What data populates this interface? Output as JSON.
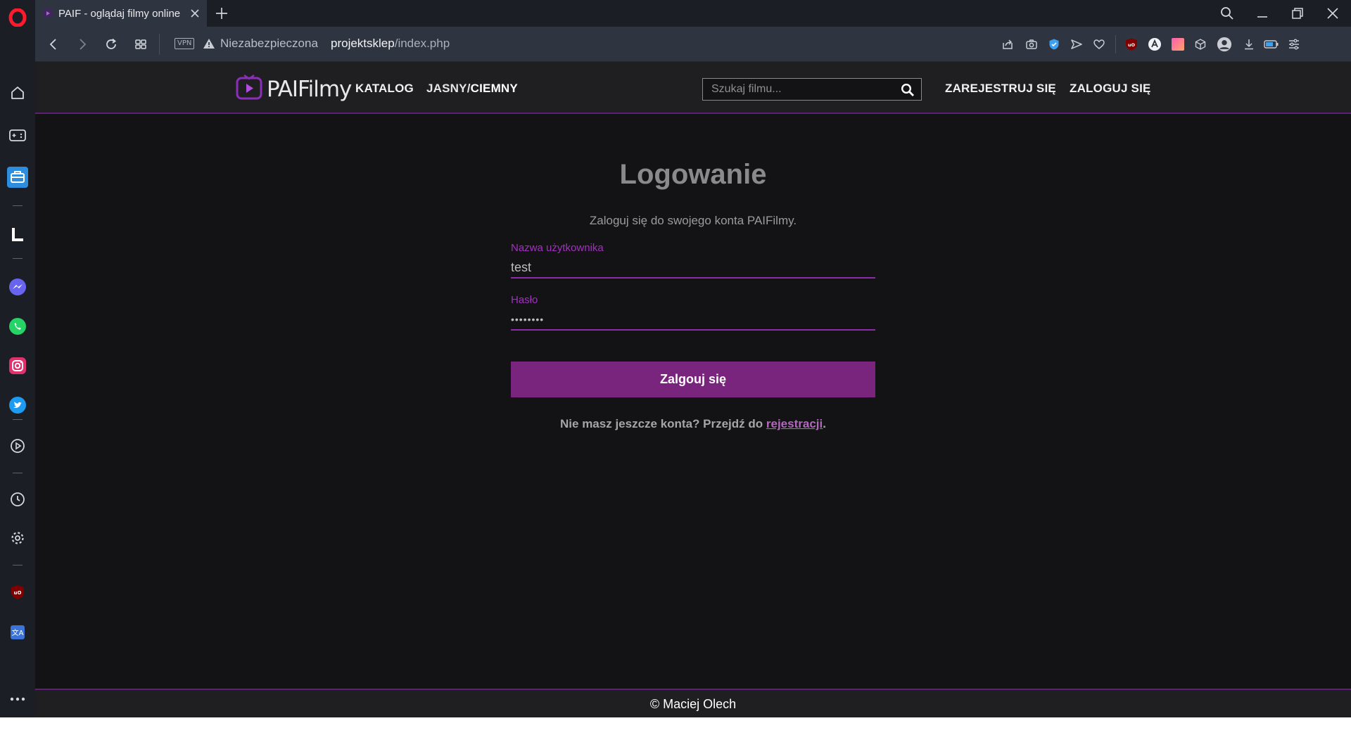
{
  "browser": {
    "tab": {
      "title": "PAIF - oglądaj filmy online"
    },
    "address": {
      "vpn_label": "VPN",
      "security_label": "Niezabezpieczona",
      "url_host": "projektsklep",
      "url_path": "/index.php"
    }
  },
  "site": {
    "logo_text": "PAIFilmy",
    "nav": {
      "catalog": "KATALOG",
      "theme_light": "JASNY",
      "theme_sep": "/",
      "theme_dark": "CIEMNY",
      "register": "ZAREJESTRUJ SIĘ",
      "login": "ZALOGUJ SIĘ"
    },
    "search": {
      "placeholder": "Szukaj filmu...",
      "value": ""
    }
  },
  "login_form": {
    "title": "Logowanie",
    "subtitle": "Zaloguj się do swojego konta PAIFilmy.",
    "username_label": "Nazwa użytkownika",
    "username_value": "test",
    "password_label": "Hasło",
    "password_value": "••••••••",
    "submit_label": "Zalgouj się",
    "register_prompt": "Nie masz jeszcze konta? Przejdź do ",
    "register_link": "rejestracji",
    "register_suffix": "."
  },
  "footer": {
    "text": "© Maciej Olech"
  },
  "colors": {
    "accent": "#7a257d",
    "accent_label": "#a32fc2",
    "page_bg": "#131315",
    "header_bg": "#1f1f21"
  }
}
